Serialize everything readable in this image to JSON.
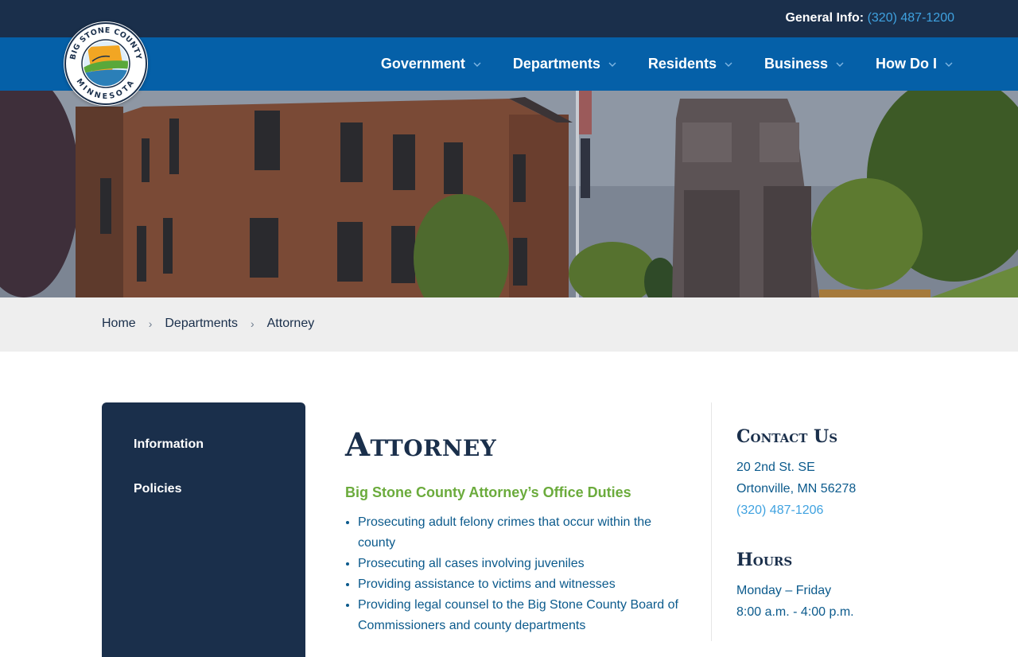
{
  "top_bar": {
    "label": "General Info:",
    "phone": "(320) 487-1200"
  },
  "logo": {
    "ring_text_top": "BIG STONE COUNTY",
    "ring_text_bottom": "MINNESOTA"
  },
  "nav": {
    "items": [
      {
        "label": "Government"
      },
      {
        "label": "Departments"
      },
      {
        "label": "Residents"
      },
      {
        "label": "Business"
      },
      {
        "label": "How Do I"
      }
    ]
  },
  "breadcrumb": {
    "items": [
      "Home",
      "Departments",
      "Attorney"
    ]
  },
  "sidebar": {
    "items": [
      "Information",
      "Policies"
    ]
  },
  "main": {
    "title": "Attorney",
    "subtitle": "Big Stone County Attorney’s Office Duties",
    "duties": [
      "Prosecuting adult felony crimes that occur within the county",
      "Prosecuting all cases involving juveniles",
      "Providing assistance to victims and witnesses",
      "Providing legal counsel to the Big Stone County Board of Commissioners and county departments"
    ]
  },
  "contact": {
    "heading": "Contact Us",
    "address_line1": "20 2nd St. SE",
    "address_line2": "Ortonville, MN 56278",
    "phone": "(320) 487-1206"
  },
  "hours": {
    "heading": "Hours",
    "days": "Monday – Friday",
    "time": "8:00 a.m. - 4:00 p.m."
  },
  "colors": {
    "navy": "#1a2f4b",
    "nav_blue": "#0560a8",
    "link_blue": "#3fa2e0",
    "green": "#6bab3c"
  }
}
